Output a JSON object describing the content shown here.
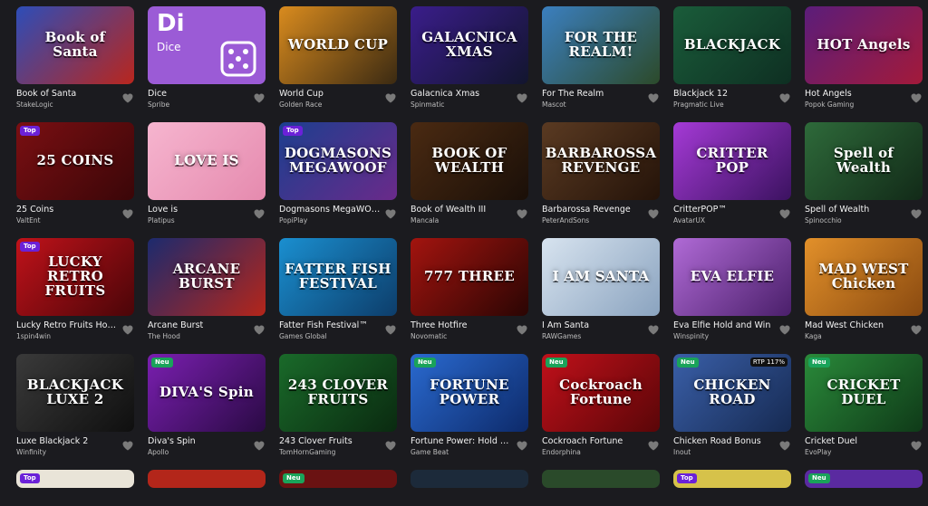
{
  "games": [
    {
      "title": "Book of Santa",
      "provider": "StakeLogic",
      "art": "Book of Santa",
      "bg": "linear-gradient(135deg,#2d4db8,#b9261d)",
      "badge": ""
    },
    {
      "title": "Dice",
      "provider": "Spribe",
      "art": "",
      "bg": "#9b5bd6",
      "badge": "",
      "dice_logo": "Di",
      "dice_label": "Dice"
    },
    {
      "title": "World Cup",
      "provider": "Golden Race",
      "art": "WORLD CUP",
      "bg": "linear-gradient(135deg,#d98b1e,#3b2a12)",
      "badge": ""
    },
    {
      "title": "Galacnica Xmas",
      "provider": "Spinmatic",
      "art": "GALACNICA XMAS",
      "bg": "linear-gradient(135deg,#3a1d8a,#12152e)",
      "badge": ""
    },
    {
      "title": "For The Realm",
      "provider": "Mascot",
      "art": "FOR THE REALM!",
      "bg": "linear-gradient(135deg,#3b7fbf,#2c4a2a)",
      "badge": ""
    },
    {
      "title": "Blackjack 12",
      "provider": "Pragmatic Live",
      "art": "BLACKJACK",
      "bg": "linear-gradient(135deg,#1a5c3a,#0e2f22)",
      "badge": ""
    },
    {
      "title": "Hot Angels",
      "provider": "Popok Gaming",
      "art": "HOT Angels",
      "bg": "linear-gradient(135deg,#5b1d7a,#a31a3a)",
      "badge": ""
    },
    {
      "title": "25 Coins",
      "provider": "ValtEnt",
      "art": "25 COINS",
      "bg": "linear-gradient(135deg,#7a0f12,#3a0608)",
      "badge": "Top"
    },
    {
      "title": "Love is",
      "provider": "Platipus",
      "art": "LOVE IS",
      "bg": "linear-gradient(135deg,#f6b5cf,#e58aae)",
      "badge": ""
    },
    {
      "title": "Dogmasons MegaWOOF",
      "provider": "PopiPlay",
      "art": "DOGMASONS MEGAWOOF",
      "bg": "linear-gradient(135deg,#1c3f8f,#6a2a8a)",
      "badge": "Top"
    },
    {
      "title": "Book of Wealth III",
      "provider": "Mancala",
      "art": "BOOK OF WEALTH",
      "bg": "linear-gradient(135deg,#4a2a12,#1a0f08)",
      "badge": ""
    },
    {
      "title": "Barbarossa Revenge",
      "provider": "PeterAndSons",
      "art": "BARBAROSSA REVENGE",
      "bg": "linear-gradient(135deg,#5a3a22,#241309)",
      "badge": ""
    },
    {
      "title": "CritterPOP™",
      "provider": "AvatarUX",
      "art": "CRITTER POP",
      "bg": "linear-gradient(135deg,#a53ad6,#3b1260)",
      "badge": ""
    },
    {
      "title": "Spell of Wealth",
      "provider": "Spinocchio",
      "art": "Spell of Wealth",
      "bg": "linear-gradient(135deg,#2e6a3a,#122a18)",
      "badge": ""
    },
    {
      "title": "Lucky Retro Fruits Hold ...",
      "provider": "1spin4win",
      "art": "LUCKY RETRO FRUITS",
      "bg": "linear-gradient(135deg,#c0121a,#4a0508)",
      "badge": "Top"
    },
    {
      "title": "Arcane Burst",
      "provider": "The Hood",
      "art": "ARCANE BURST",
      "bg": "linear-gradient(135deg,#1c2a6e,#b4261a)",
      "badge": ""
    },
    {
      "title": "Fatter Fish Festival™",
      "provider": "Games Global",
      "art": "FATTER FISH FESTIVAL",
      "bg": "linear-gradient(135deg,#1a8fd0,#0d3d6a)",
      "badge": ""
    },
    {
      "title": "Three Hotfire",
      "provider": "Novomatic",
      "art": "777 THREE",
      "bg": "linear-gradient(135deg,#a3140f,#2a0503)",
      "badge": ""
    },
    {
      "title": "I Am Santa",
      "provider": "RAWGames",
      "art": "I AM SANTA",
      "bg": "linear-gradient(135deg,#d7e3ef,#8aa3bf)",
      "badge": ""
    },
    {
      "title": "Eva Elfie Hold and Win",
      "provider": "Winspinity",
      "art": "EVA ELFIE",
      "bg": "linear-gradient(135deg,#b06ad6,#4a1f6a)",
      "badge": ""
    },
    {
      "title": "Mad West Chicken",
      "provider": "Kaga",
      "art": "MAD WEST Chicken",
      "bg": "linear-gradient(135deg,#e2902a,#8a4a10)",
      "badge": ""
    },
    {
      "title": "Luxe Blackjack 2",
      "provider": "Winfinity",
      "art": "BLACKJACK LUXE 2",
      "bg": "linear-gradient(135deg,#3a3a3a,#0f0f0f)",
      "badge": ""
    },
    {
      "title": "Diva's Spin",
      "provider": "Apollo",
      "art": "DIVA'S Spin",
      "bg": "linear-gradient(135deg,#7a1fb0,#2a0a44)",
      "badge": "Neu"
    },
    {
      "title": "243 Clover Fruits",
      "provider": "TomHornGaming",
      "art": "243 CLOVER FRUITS",
      "bg": "linear-gradient(135deg,#1a6a2a,#0a2a10)",
      "badge": ""
    },
    {
      "title": "Fortune Power: Hold & ...",
      "provider": "Game Beat",
      "art": "FORTUNE POWER",
      "bg": "linear-gradient(135deg,#2a6ad0,#0d2a6a)",
      "badge": "Neu"
    },
    {
      "title": "Cockroach Fortune",
      "provider": "Endorphina",
      "art": "Cockroach Fortune",
      "bg": "linear-gradient(135deg,#c0101a,#5a0608)",
      "badge": "Neu"
    },
    {
      "title": "Chicken Road Bonus",
      "provider": "Inout",
      "art": "CHICKEN ROAD",
      "bg": "linear-gradient(135deg,#3a5fa8,#162a52)",
      "badge": "Neu",
      "rtp": "RTP 117%"
    },
    {
      "title": "Cricket Duel",
      "provider": "EvoPlay",
      "art": "CRICKET DUEL",
      "bg": "linear-gradient(135deg,#2a8a3a,#0f3a18)",
      "badge": "Neu"
    }
  ],
  "partial_row": [
    {
      "bg": "#e9e4d8",
      "badge": "Top"
    },
    {
      "bg": "#b3261a",
      "badge": ""
    },
    {
      "bg": "#6a1212",
      "badge": "Neu"
    },
    {
      "bg": "#1c2a3a",
      "badge": ""
    },
    {
      "bg": "#2a4a2a",
      "badge": ""
    },
    {
      "bg": "#d6c24a",
      "badge": "Top"
    },
    {
      "bg": "#5a2aa0",
      "badge": "Neu"
    }
  ],
  "colors": {
    "background": "#1b1b1f",
    "title": "#f3f3f3",
    "provider": "#bdbdbd",
    "heart": "#7a7a7a",
    "badge_top": "#6b21d8",
    "badge_new": "#1aa35a"
  },
  "icons": {
    "favorite": "heart-icon",
    "dice": "dice-icon"
  }
}
